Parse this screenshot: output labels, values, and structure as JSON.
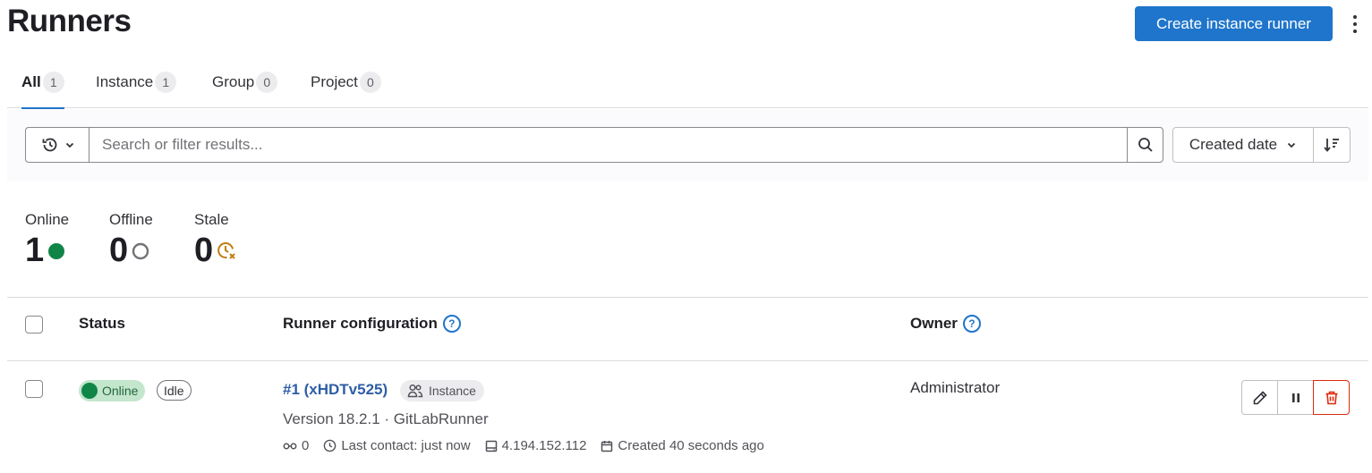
{
  "page": {
    "title": "Runners"
  },
  "header": {
    "create_button": "Create instance runner"
  },
  "tabs": [
    {
      "label": "All",
      "count": "1",
      "active": true
    },
    {
      "label": "Instance",
      "count": "1"
    },
    {
      "label": "Group",
      "count": "0"
    },
    {
      "label": "Project",
      "count": "0"
    }
  ],
  "search": {
    "placeholder": "Search or filter results...",
    "value": ""
  },
  "sort": {
    "label": "Created date"
  },
  "stats": [
    {
      "label": "Online",
      "value": "1",
      "icon": "online-status-icon",
      "color": "#108548"
    },
    {
      "label": "Offline",
      "value": "0",
      "icon": "offline-status-icon",
      "color": "#737278"
    },
    {
      "label": "Stale",
      "value": "0",
      "icon": "stale-clock-icon",
      "color": "#c17d10"
    }
  ],
  "table": {
    "headers": {
      "status": "Status",
      "config": "Runner configuration",
      "owner": "Owner"
    },
    "rows": [
      {
        "status": "Online",
        "state": "Idle",
        "name": "#1 (xHDTv525)",
        "type": "Instance",
        "version": "Version 18.2.1 · GitLabRunner",
        "jobs": "0",
        "last_contact": "Last contact: just now",
        "ip": "4.194.152.112",
        "created": "Created 40 seconds ago",
        "owner": "Administrator"
      }
    ]
  },
  "colors": {
    "primary": "#1f75cb",
    "danger": "#dd2b0e",
    "success": "#108548",
    "link": "#2f5ea7"
  }
}
